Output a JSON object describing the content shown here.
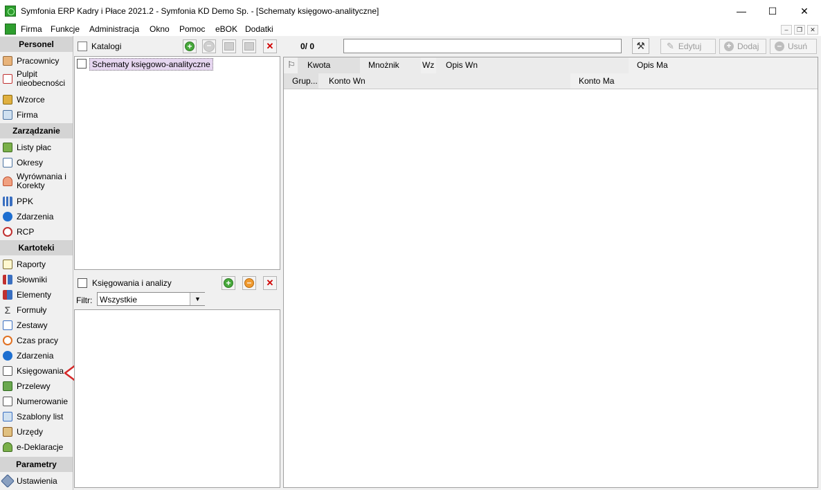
{
  "window": {
    "title": "Symfonia ERP Kadry i Płace 2021.2 - Symfonia KD Demo Sp. - [Schematy księgowo-analityczne]",
    "minimize": "—",
    "maximize": "☐",
    "close": "✕"
  },
  "menu": {
    "items": [
      "Firma",
      "Funkcje",
      "Administracja",
      "Okno",
      "Pomoc",
      "eBOK",
      "Dodatki"
    ],
    "mdi_min": "–",
    "mdi_restore": "❐",
    "mdi_close": "✕"
  },
  "sidebar": {
    "sections": [
      {
        "title": "Personel",
        "items": [
          "Pracownicy",
          "Pulpit nieobecności",
          "Wzorce",
          "Firma"
        ]
      },
      {
        "title": "Zarządzanie",
        "items": [
          "Listy płac",
          "Okresy",
          "Wyrównania i Korekty",
          "PPK",
          "Zdarzenia",
          "RCP"
        ]
      },
      {
        "title": "Kartoteki",
        "items": [
          "Raporty",
          "Słowniki",
          "Elementy",
          "Formuły",
          "Zestawy",
          "Czas pracy",
          "Zdarzenia",
          "Księgowania",
          "Przelewy",
          "Numerowanie",
          "Szablony list",
          "Urzędy",
          "e-Deklaracje"
        ]
      },
      {
        "title": "Parametry",
        "items": [
          "Ustawienia"
        ]
      }
    ]
  },
  "catalogs": {
    "title": "Katalogi",
    "tree_item": "Schematy księgowo-analityczne"
  },
  "postings": {
    "title": "Księgowania i analizy",
    "filter_label": "Filtr:",
    "filter_value": "Wszystkie"
  },
  "grid": {
    "counter": "0/ 0",
    "search_value": "",
    "buttons": {
      "edit": "Edytuj",
      "add": "Dodaj",
      "delete": "Usuń"
    },
    "columns_row1": [
      "Kwota",
      "Mnożnik",
      "Wz",
      "Opis Wn",
      "Opis Ma"
    ],
    "columns_row2": [
      "Grup...",
      "Konto Wn",
      "Konto Ma"
    ]
  },
  "colors": {
    "accent_green": "#47a93b",
    "selection": "#e6d6f0",
    "arrow": "#d62828"
  }
}
